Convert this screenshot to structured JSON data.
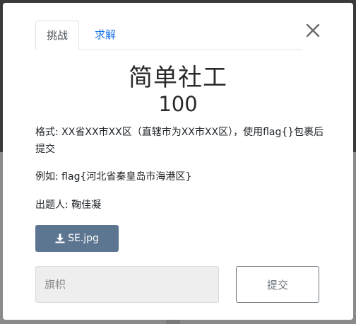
{
  "modal": {
    "tabs": [
      {
        "label": "挑战",
        "active": true
      },
      {
        "label": "求解",
        "active": false
      }
    ],
    "challenge": {
      "name": "简单社工",
      "points": "100",
      "description": [
        "格式: XX省XX市XX区（直辖市为XX市XX区），使用flag{}包裹后提交",
        "例如: flag{河北省秦皇岛市海港区}",
        "出题人: 鞠佳凝"
      ],
      "file": {
        "label": "SE.jpg",
        "icon": "download-icon"
      }
    },
    "form": {
      "flag_placeholder": "旗帜",
      "flag_value": "",
      "submit_label": "提交"
    }
  },
  "colors": {
    "tab_link": "#1a73e8",
    "download_button": "#5c7590",
    "submit_border": "#6c757d",
    "input_bg": "#eeeeee"
  }
}
